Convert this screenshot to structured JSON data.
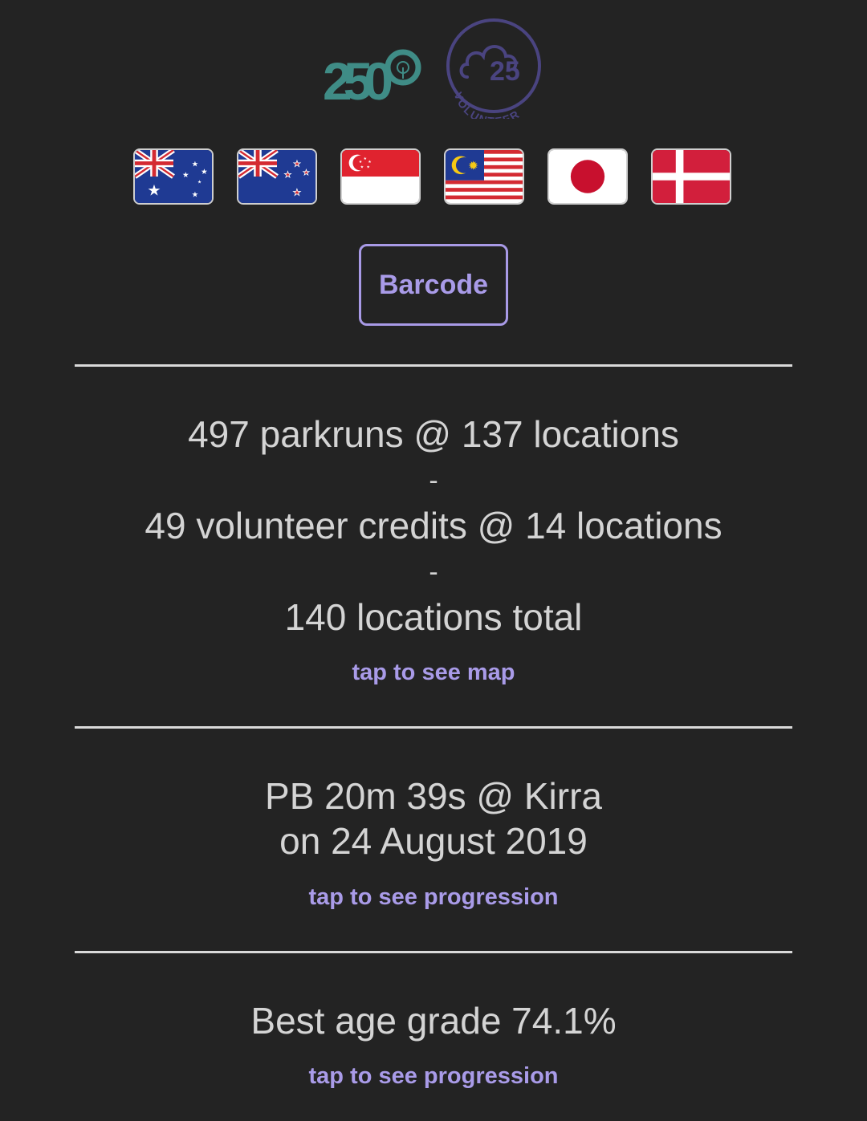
{
  "badges": {
    "runs_badge": {
      "number": "250",
      "color": "#3f8c86",
      "icon": "tree-icon"
    },
    "volunteer_badge": {
      "number": "25",
      "label": "VOLUNTEER",
      "color": "#4a4480",
      "icon": "cloud-icon"
    }
  },
  "flags": [
    {
      "country": "australia",
      "icon": "australia-flag-icon"
    },
    {
      "country": "new-zealand",
      "icon": "new-zealand-flag-icon"
    },
    {
      "country": "singapore",
      "icon": "singapore-flag-icon"
    },
    {
      "country": "malaysia",
      "icon": "malaysia-flag-icon"
    },
    {
      "country": "japan",
      "icon": "japan-flag-icon"
    },
    {
      "country": "denmark",
      "icon": "denmark-flag-icon"
    }
  ],
  "barcode_button": {
    "label": "Barcode"
  },
  "locations": {
    "parkruns": "497 parkruns @ 137 locations",
    "separator1": "-",
    "volunteer": "49 volunteer credits @ 14 locations",
    "separator2": "-",
    "total": "140 locations total",
    "link": "tap to see map"
  },
  "pb": {
    "line1": "PB 20m 39s @ Kirra",
    "line2": "on 24 August 2019",
    "link": "tap to see progression"
  },
  "age_grade": {
    "line": "Best age grade 74.1%",
    "link": "tap to see progression"
  },
  "colors": {
    "background": "#232323",
    "text": "#d4d4d4",
    "accent": "#a99be8",
    "divider": "#d9d9d9"
  }
}
